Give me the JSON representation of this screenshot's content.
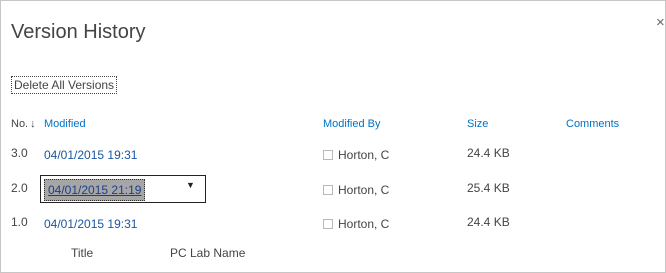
{
  "dialog": {
    "title": "Version History",
    "close_glyph": "×",
    "delete_all_label": "Delete All Versions"
  },
  "columns": {
    "no": "No.",
    "sort_arrow": "↓",
    "modified": "Modified",
    "modified_by": "Modified By",
    "size": "Size",
    "comments": "Comments"
  },
  "rows": [
    {
      "no": "3.0",
      "modified": "04/01/2015 19:31",
      "modified_by": "Horton, C",
      "size": "24.4 KB"
    },
    {
      "no": "2.0",
      "modified": "04/01/2015 21:19",
      "modified_by": "Horton, C",
      "size": "25.4 KB",
      "selected": true
    },
    {
      "no": "1.0",
      "modified": "04/01/2015 19:31",
      "modified_by": "Horton, C",
      "size": "24.4 KB"
    }
  ],
  "detail": {
    "field_label": "Title",
    "field_value": "PC Lab Name"
  },
  "icons": {
    "dropdown": "chevron-down-icon",
    "presence": "presence-checkbox-icon",
    "close": "close-icon"
  },
  "colors": {
    "link": "#1a57a0",
    "header_link": "#0072c6",
    "selected_bg": "#a6a6a6"
  }
}
